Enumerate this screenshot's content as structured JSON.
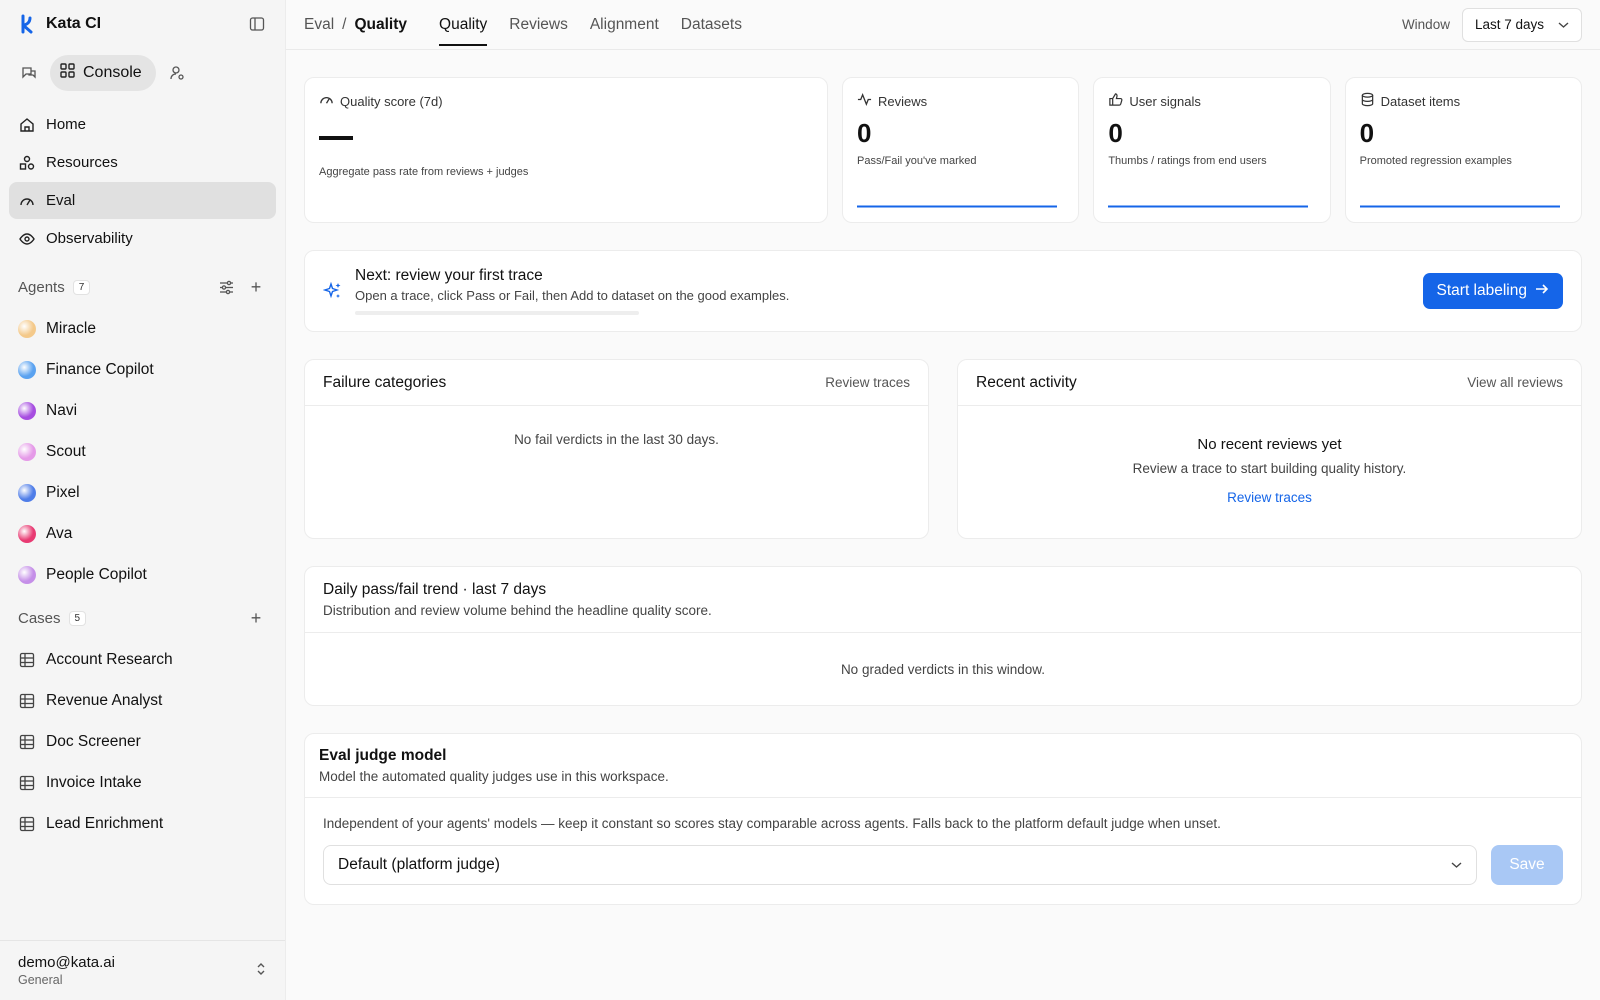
{
  "app": {
    "name": "Kata CI",
    "mode_label": "Console"
  },
  "nav": [
    {
      "label": "Home",
      "icon": "home-icon"
    },
    {
      "label": "Resources",
      "icon": "shapes-icon"
    },
    {
      "label": "Eval",
      "icon": "gauge-icon",
      "active": true
    },
    {
      "label": "Observability",
      "icon": "eye-icon"
    }
  ],
  "agents": {
    "label": "Agents",
    "count": "7",
    "items": [
      {
        "label": "Miracle",
        "color": "#f4c98a"
      },
      {
        "label": "Finance Copilot",
        "color": "#5aa2f0"
      },
      {
        "label": "Navi",
        "color": "#a64de0"
      },
      {
        "label": "Scout",
        "color": "#e59ae8"
      },
      {
        "label": "Pixel",
        "color": "#4f7de8"
      },
      {
        "label": "Ava",
        "color": "#e83a72"
      },
      {
        "label": "People Copilot",
        "color": "#c58fe8"
      }
    ]
  },
  "cases": {
    "label": "Cases",
    "count": "5",
    "items": [
      {
        "label": "Account Research"
      },
      {
        "label": "Revenue Analyst"
      },
      {
        "label": "Doc Screener"
      },
      {
        "label": "Invoice Intake"
      },
      {
        "label": "Lead Enrichment"
      }
    ]
  },
  "user": {
    "email": "demo@kata.ai",
    "workspace": "General"
  },
  "breadcrumb": {
    "parent": "Eval",
    "sep": "/",
    "current": "Quality"
  },
  "tabs": [
    {
      "label": "Quality",
      "active": true
    },
    {
      "label": "Reviews"
    },
    {
      "label": "Alignment"
    },
    {
      "label": "Datasets"
    }
  ],
  "window": {
    "label": "Window",
    "value": "Last 7 days"
  },
  "stats": {
    "quality": {
      "title": "Quality score (7d)",
      "desc": "Aggregate pass rate from reviews + judges"
    },
    "reviews": {
      "title": "Reviews",
      "value": "0",
      "desc": "Pass/Fail you've marked"
    },
    "signals": {
      "title": "User signals",
      "value": "0",
      "desc": "Thumbs / ratings from end users"
    },
    "dataset": {
      "title": "Dataset items",
      "value": "0",
      "desc": "Promoted regression examples"
    }
  },
  "next_step": {
    "title": "Next: review your first trace",
    "desc": "Open a trace, click Pass or Fail, then Add to dataset on the good examples.",
    "progress": 0,
    "button": "Start labeling"
  },
  "failure": {
    "title": "Failure categories",
    "link": "Review traces",
    "empty": "No fail verdicts in the last 30 days."
  },
  "activity": {
    "title": "Recent activity",
    "link": "View all reviews",
    "empty_title": "No recent reviews yet",
    "empty_sub": "Review a trace to start building quality history.",
    "empty_link": "Review traces"
  },
  "trend": {
    "title": "Daily pass/fail trend · last 7 days",
    "sub": "Distribution and review volume behind the headline quality score.",
    "empty": "No graded verdicts in this window."
  },
  "judge": {
    "title": "Eval judge model",
    "sub": "Model the automated quality judges use in this workspace.",
    "note": "Independent of your agents' models — keep it constant so scores stay comparable across agents. Falls back to the platform default judge when unset.",
    "selected": "Default (platform judge)",
    "save": "Save"
  },
  "colors": {
    "accent": "#1565e8",
    "save_disabled": "#a9c8f5"
  }
}
